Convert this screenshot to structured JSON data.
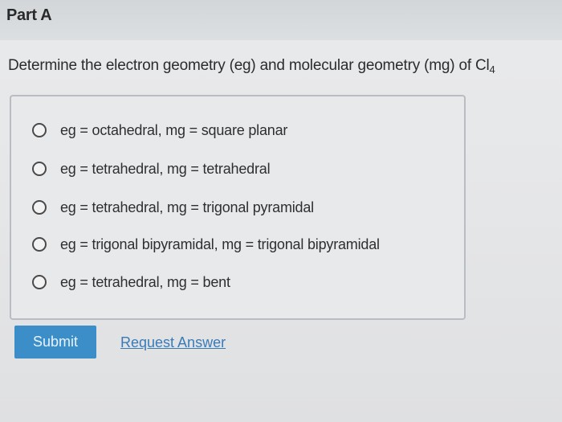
{
  "header": {
    "part_label": "Part A"
  },
  "question": {
    "text": "Determine the electron geometry (eg) and molecular geometry (mg) of Cl",
    "subscript": "4"
  },
  "options": [
    {
      "label": "eg = octahedral, mg = square planar"
    },
    {
      "label": "eg = tetrahedral, mg = tetrahedral"
    },
    {
      "label": "eg = tetrahedral, mg = trigonal pyramidal"
    },
    {
      "label": "eg = trigonal bipyramidal, mg = trigonal bipyramidal"
    },
    {
      "label": "eg = tetrahedral, mg = bent"
    }
  ],
  "actions": {
    "submit_label": "Submit",
    "request_answer_label": "Request Answer"
  },
  "colors": {
    "submit_bg": "#3b8ec8",
    "link": "#3a7bb7"
  }
}
